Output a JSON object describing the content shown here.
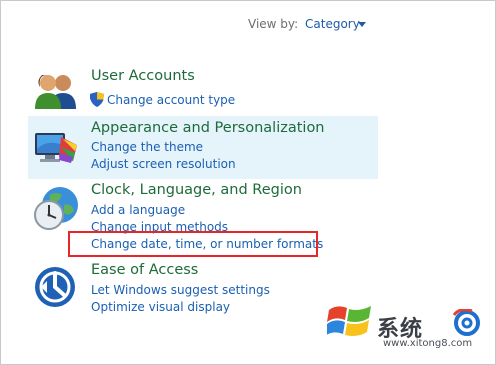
{
  "view_by": {
    "label": "View by:",
    "value": "Category"
  },
  "categories": [
    {
      "title": "User Accounts",
      "icon": "user-accounts-icon",
      "links": [
        "Change account type"
      ]
    },
    {
      "title": "Appearance and Personalization",
      "icon": "appearance-icon",
      "links": [
        "Change the theme",
        "Adjust screen resolution"
      ]
    },
    {
      "title": "Clock, Language, and Region",
      "icon": "clock-globe-icon",
      "links": [
        "Add a language",
        "Change input methods",
        "Change date, time, or number formats"
      ]
    },
    {
      "title": "Ease of Access",
      "icon": "ease-of-access-icon",
      "links": [
        "Let Windows suggest settings",
        "Optimize visual display"
      ]
    }
  ],
  "watermark": {
    "brand": "系统",
    "url": "www.xitong8.com",
    "logo": "windows-logo-icon"
  },
  "colors": {
    "title": "#1e6b3a",
    "link": "#1a5fb4",
    "highlight": "#e5f3fb",
    "annotation": "#e8262a"
  }
}
